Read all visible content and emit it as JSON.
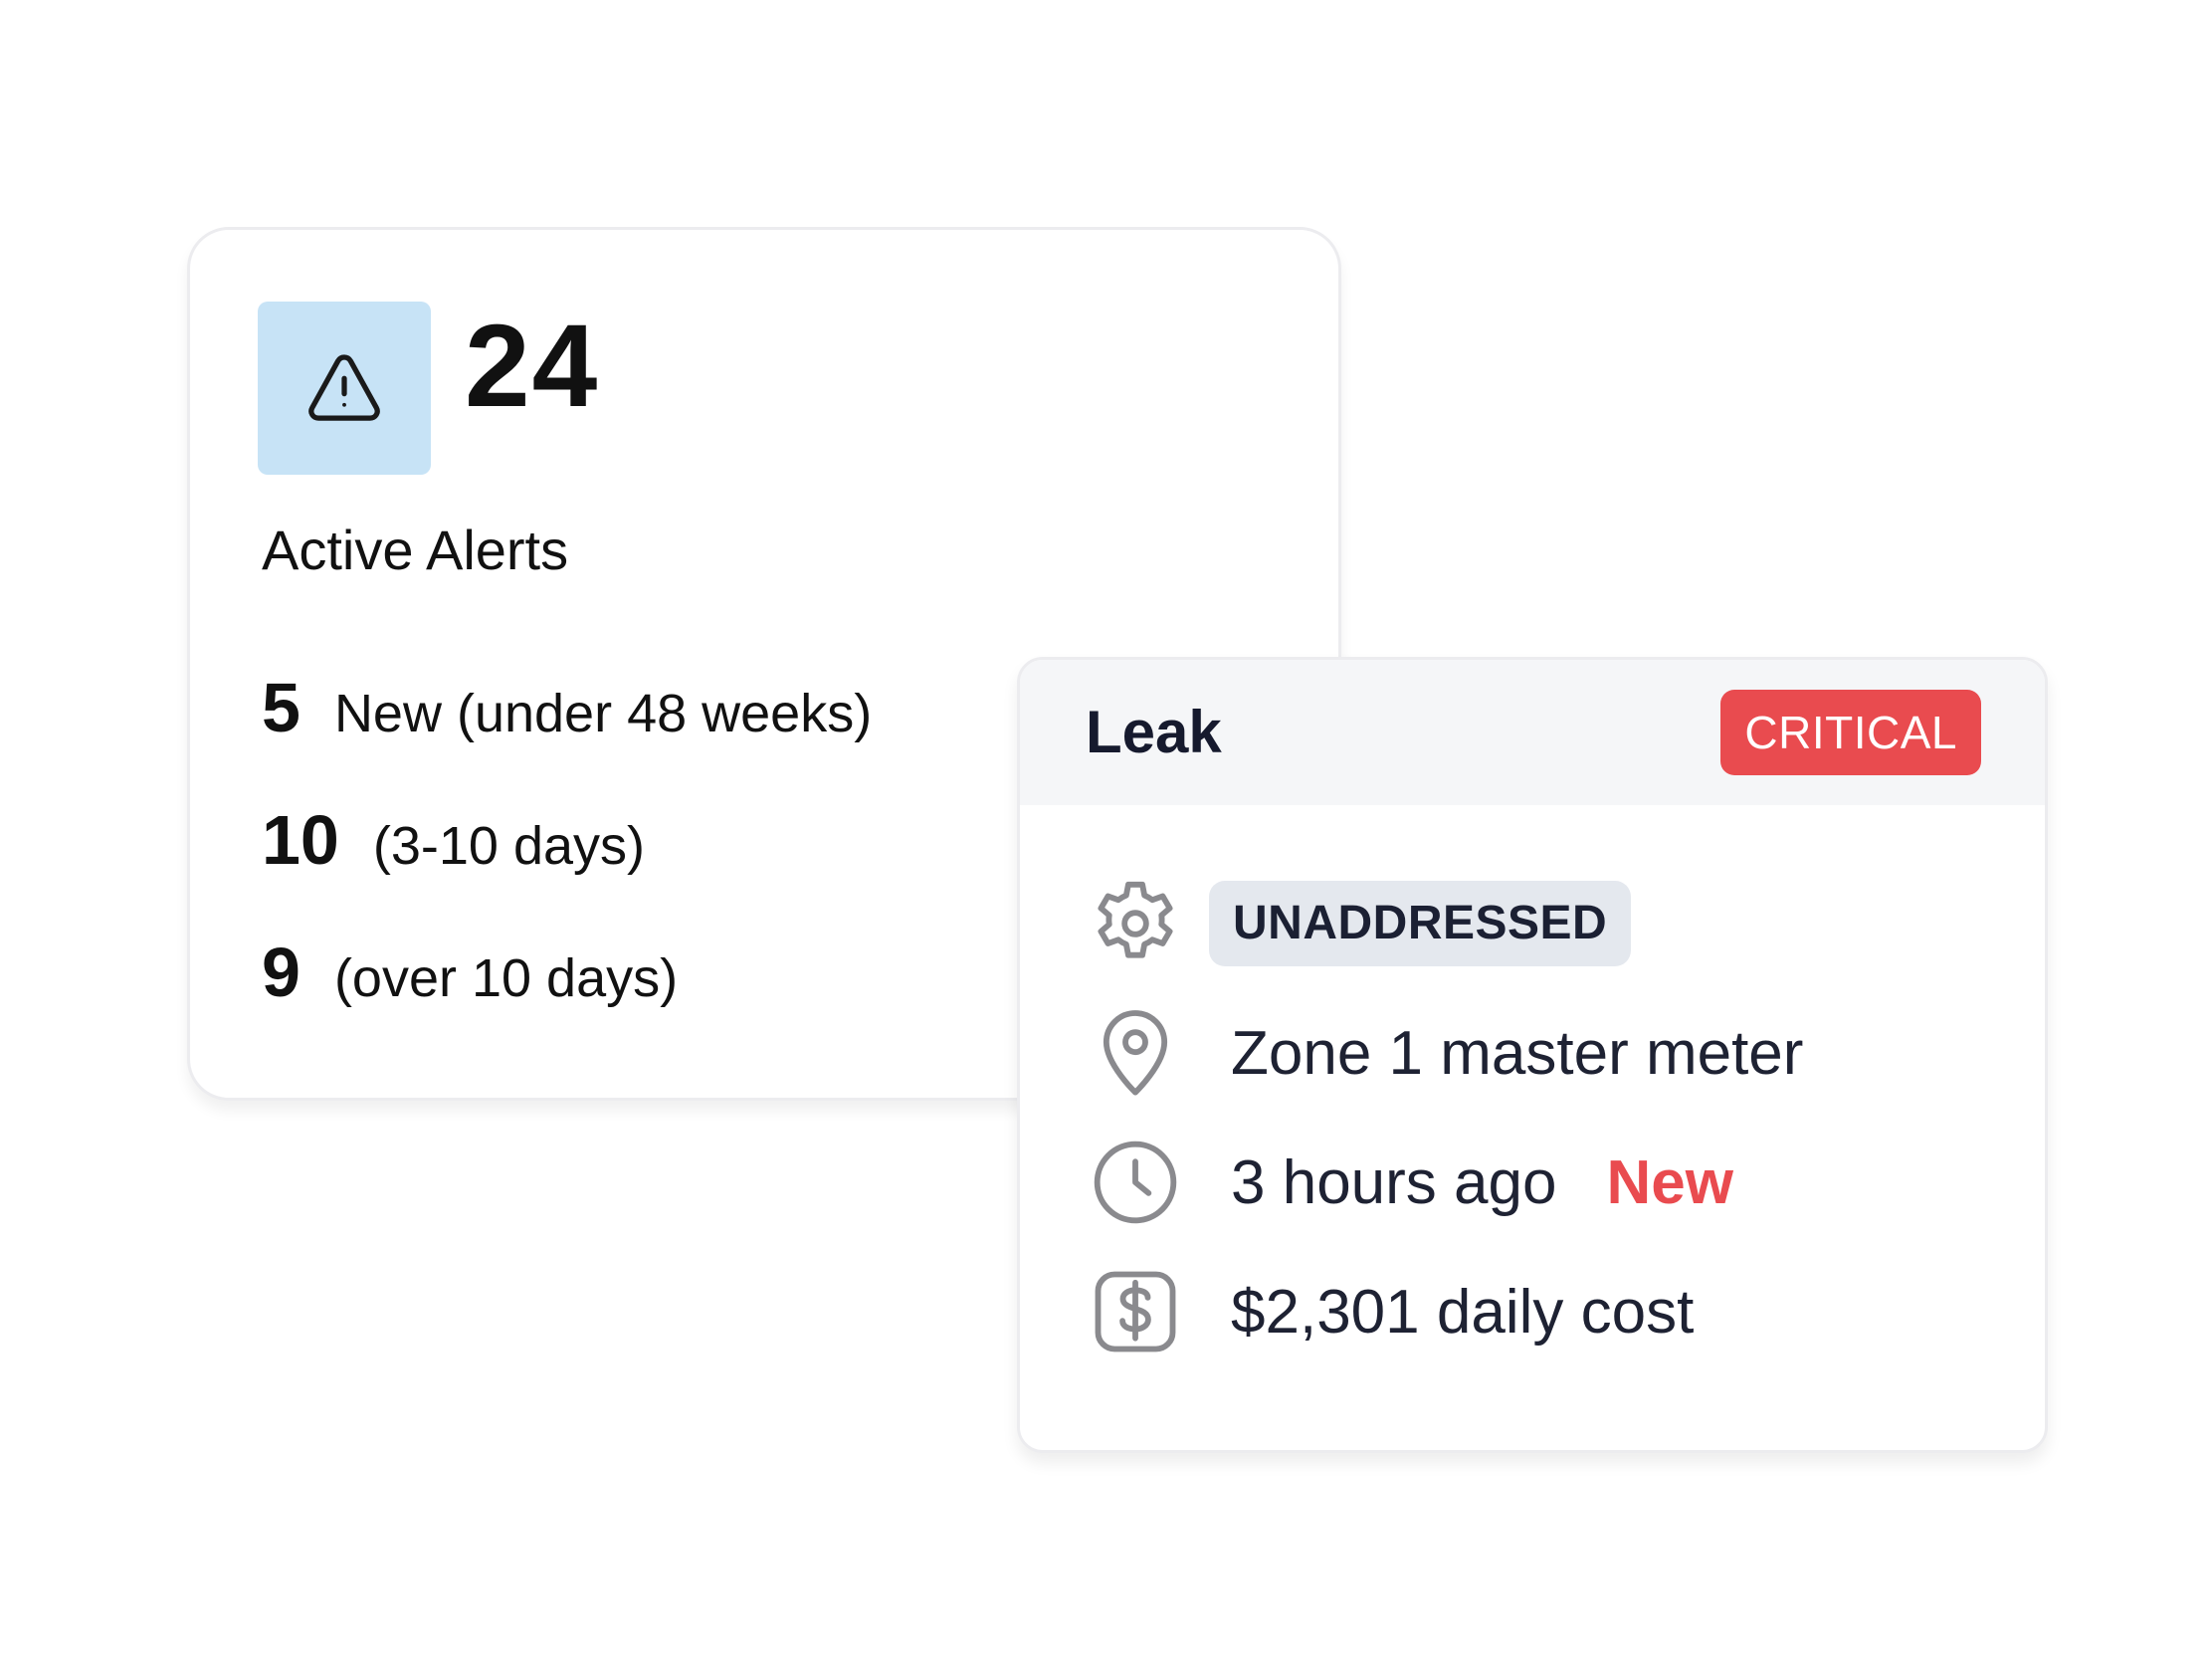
{
  "alerts_card": {
    "total": "24",
    "title": "Active Alerts",
    "icon": "warning-triangle-icon",
    "icon_bg_color": "#c7e3f6",
    "rows": [
      {
        "count": "5",
        "label": "New (under 48 weeks)"
      },
      {
        "count": "10",
        "label": "(3-10 days)"
      },
      {
        "count": "9",
        "label": "(over 10 days)"
      }
    ]
  },
  "leak_card": {
    "title": "Leak",
    "severity": "CRITICAL",
    "severity_color": "#e94b4f",
    "status": "UNADDRESSED",
    "location": "Zone 1 master meter",
    "time": "3 hours ago",
    "new_tag": "New",
    "cost": "$2,301 daily cost",
    "icons": [
      "gear-icon",
      "location-pin-icon",
      "clock-icon",
      "dollar-icon"
    ]
  }
}
